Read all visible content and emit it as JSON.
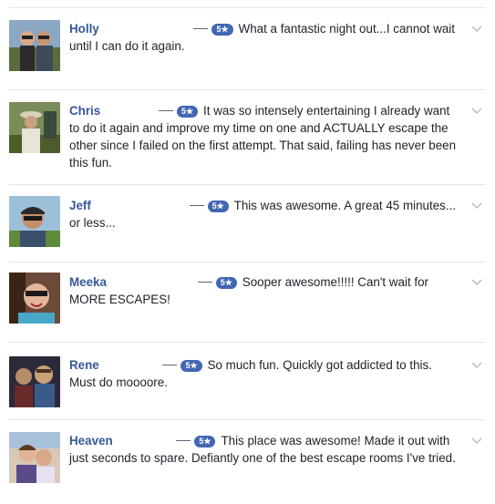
{
  "reviews": [
    {
      "name": "Holly",
      "rating": "5★",
      "text": "What a fantastic night out...I cannot wait until I can do it again."
    },
    {
      "name": "Chris",
      "rating": "5★",
      "text": "It was so intensely entertaining I already want to do it again and improve my time on one and ACTUALLY escape the other since I failed on the first attempt. That said, failing has never been this fun."
    },
    {
      "name": "Jeff",
      "rating": "5★",
      "text": "This was awesome. A great 45 minutes... or less..."
    },
    {
      "name": "Meeka",
      "rating": "5★",
      "text": "Sooper awesome!!!!! Can't wait for MORE ESCAPES!"
    },
    {
      "name": "Rene",
      "rating": "5★",
      "text": "So much fun. Quickly got addicted to this. Must do moooore."
    },
    {
      "name": "Heaven",
      "rating": "5★",
      "text": "This place was awesome! Made it out with just seconds to spare. Defiantly one of the best escape rooms I've tried."
    }
  ],
  "colors": {
    "name_link": "#365899",
    "badge_bg": "#4267b2",
    "divider": "#e5e6e9",
    "chevron": "#bec3c9"
  },
  "icons": {
    "options": "chevron-down-icon"
  }
}
